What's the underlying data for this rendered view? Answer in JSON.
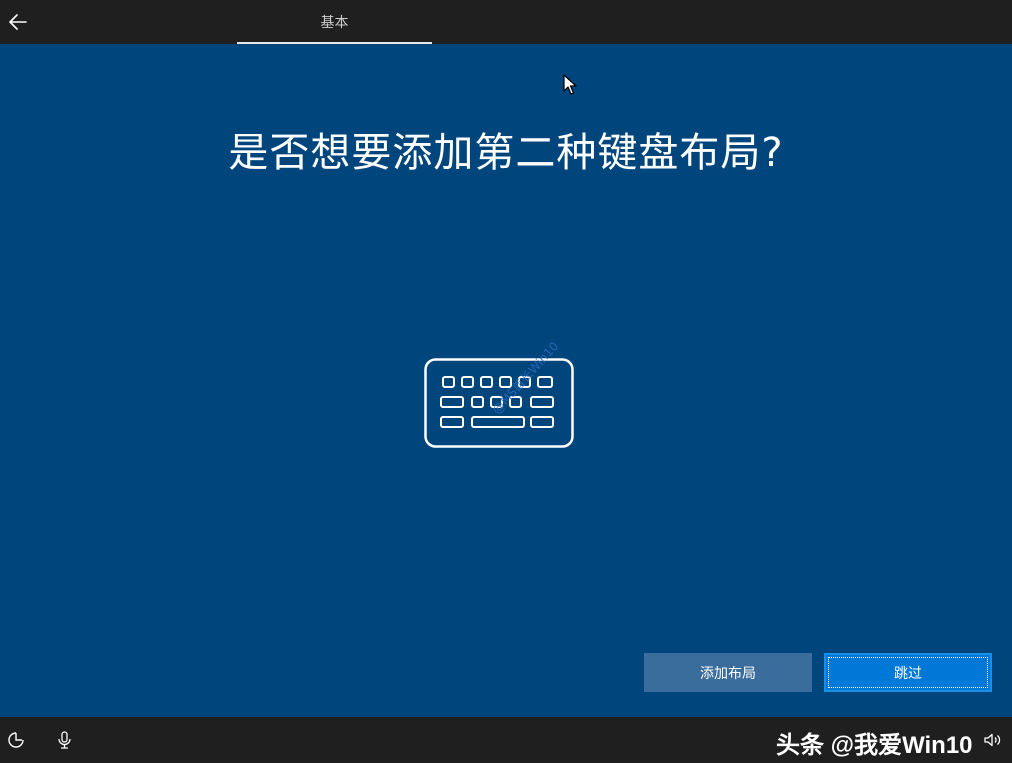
{
  "header": {
    "tab_label": "基本"
  },
  "main": {
    "title": "是否想要添加第二种键盘布局?",
    "watermark": "@MS酋长Win10"
  },
  "actions": {
    "add_layout_label": "添加布局",
    "skip_label": "跳过"
  },
  "footer": {
    "brand": "头条 @我爱Win10"
  },
  "icons": {
    "back": "arrow-left-icon",
    "keyboard": "keyboard-icon",
    "ease_of_access": "ease-of-access-icon",
    "microphone": "microphone-icon",
    "volume": "volume-icon"
  },
  "colors": {
    "background": "#00457c",
    "bar": "#1f1f1f",
    "add_button": "#3a6c9c",
    "skip_button": "#0078d7"
  }
}
